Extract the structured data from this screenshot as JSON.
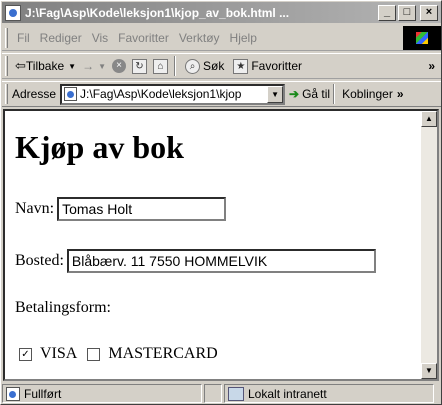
{
  "window": {
    "title": "J:\\Fag\\Asp\\Kode\\leksjon1\\kjop_av_bok.html ...",
    "buttons": [
      "_",
      "□",
      "×"
    ]
  },
  "menubar": {
    "items": [
      "Fil",
      "Rediger",
      "Vis",
      "Favoritter",
      "Verktøy",
      "Hjelp"
    ]
  },
  "toolbar": {
    "back_label": "Tilbake",
    "forward_symbol": "→",
    "search_label": "Søk",
    "favorites_label": "Favoritter",
    "more": "»"
  },
  "addressbar": {
    "label": "Adresse",
    "value": "J:\\Fag\\Asp\\Kode\\leksjon1\\kjop",
    "go_label": "Gå til",
    "links_label": "Koblinger",
    "more": "»"
  },
  "page": {
    "heading": "Kjøp av bok",
    "name_label": "Navn:",
    "name_value": "Tomas Holt",
    "address_label": "Bosted:",
    "address_value": "Blåbærv. 11 7550 HOMMELVIK",
    "payment_label": "Betalingsform:",
    "options": [
      {
        "label": "VISA",
        "checked": true
      },
      {
        "label": "MASTERCARD",
        "checked": false
      }
    ]
  },
  "statusbar": {
    "status": "Fullført",
    "zone": "Lokalt intranett"
  }
}
